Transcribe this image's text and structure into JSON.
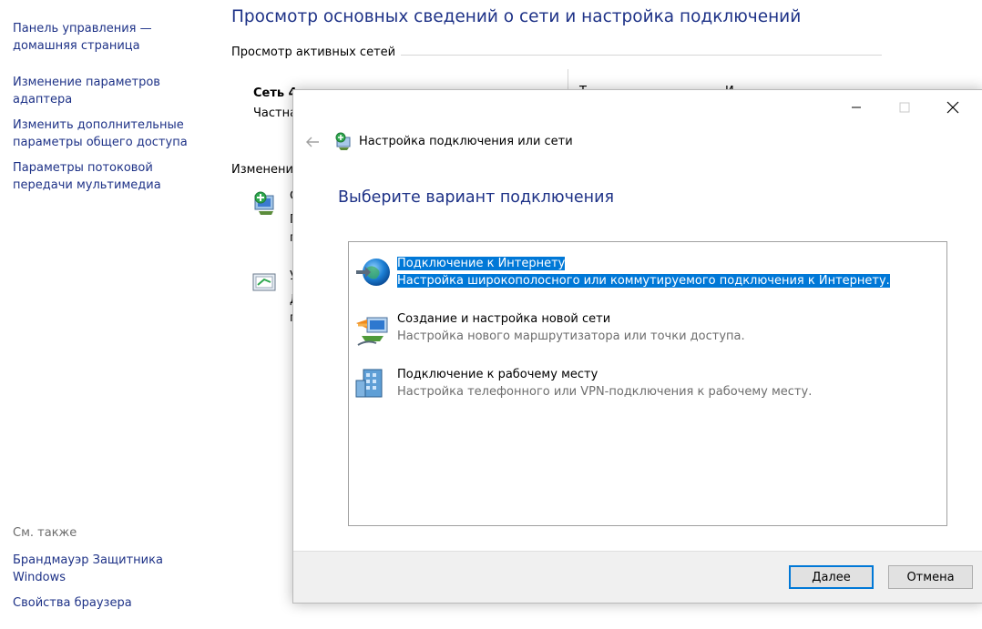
{
  "sidebar": {
    "home": "Панель управления — домашняя страница",
    "adapter": "Изменение параметров адаптера",
    "sharing": "Изменить дополнительные параметры общего доступа",
    "streaming": "Параметры потоковой передачи мультимедиа",
    "see_also": "См. также",
    "firewall": "Брандмауэр Защитника Windows",
    "browser": "Свойства браузера"
  },
  "main": {
    "title": "Просмотр основных сведений о сети и настройка подключений",
    "active_networks": "Просмотр активных сетей",
    "network_name": "Сеть 4",
    "network_type": "Частна",
    "change_settings": "Изменени",
    "right_frag_1": "Т",
    "right_frag_2": "И"
  },
  "dialog": {
    "window_title": "Настройка подключения или сети",
    "heading": "Выберите вариант подключения",
    "options": [
      {
        "title": "Подключение к Интернету",
        "description": "Настройка широкополосного или коммутируемого подключения к Интернету.",
        "selected": true
      },
      {
        "title": "Создание и настройка новой сети",
        "description": "Настройка нового маршрутизатора или точки доступа."
      },
      {
        "title": "Подключение к рабочему месту",
        "description": "Настройка телефонного или VPN-подключения к рабочему месту."
      }
    ],
    "next_label": "Далее",
    "cancel_label": "Отмена"
  },
  "colors": {
    "link": "#1e3287",
    "selection": "#0078d7",
    "footer": "#f0f0f0"
  },
  "icons": {
    "back": "back-arrow-icon",
    "title": "network-setup-icon",
    "option1": "globe-internet-icon",
    "option2": "new-network-icon",
    "option3": "workplace-building-icon"
  }
}
